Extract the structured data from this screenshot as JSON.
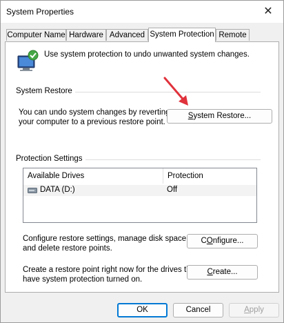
{
  "window": {
    "title": "System Properties",
    "close_glyph": "✕"
  },
  "tabs": [
    {
      "label": "Computer Name",
      "active": false
    },
    {
      "label": "Hardware",
      "active": false
    },
    {
      "label": "Advanced",
      "active": false
    },
    {
      "label": "System Protection",
      "active": true
    },
    {
      "label": "Remote",
      "active": false
    }
  ],
  "intro": {
    "icon": "system-protection-icon",
    "text": "Use system protection to undo unwanted system changes."
  },
  "system_restore": {
    "heading": "System Restore",
    "description_line1": "You can undo system changes by reverting",
    "description_line2": "your computer to a previous restore point.",
    "button_mnemonic": "S",
    "button_rest": "ystem Restore..."
  },
  "protection": {
    "heading": "Protection Settings",
    "columns": [
      "Available Drives",
      "Protection"
    ],
    "drives": [
      {
        "icon": "drive-icon",
        "name": "DATA (D:)",
        "protection": "Off"
      }
    ]
  },
  "configure": {
    "description_line1": "Configure restore settings, manage disk space,",
    "description_line2": "and delete restore points.",
    "button_mnemonic": "O",
    "button_pre": "C",
    "button_rest": "nfigure..."
  },
  "create": {
    "description_line1": "Create a restore point right now for the drives that",
    "description_line2": "have system protection turned on.",
    "button_mnemonic": "C",
    "button_rest": "reate..."
  },
  "footer": {
    "ok_label": "OK",
    "cancel_label": "Cancel",
    "apply_mnemonic": "A",
    "apply_rest": "pply"
  },
  "colors": {
    "accent": "#0078d4",
    "annotation_arrow": "#e0323c"
  }
}
